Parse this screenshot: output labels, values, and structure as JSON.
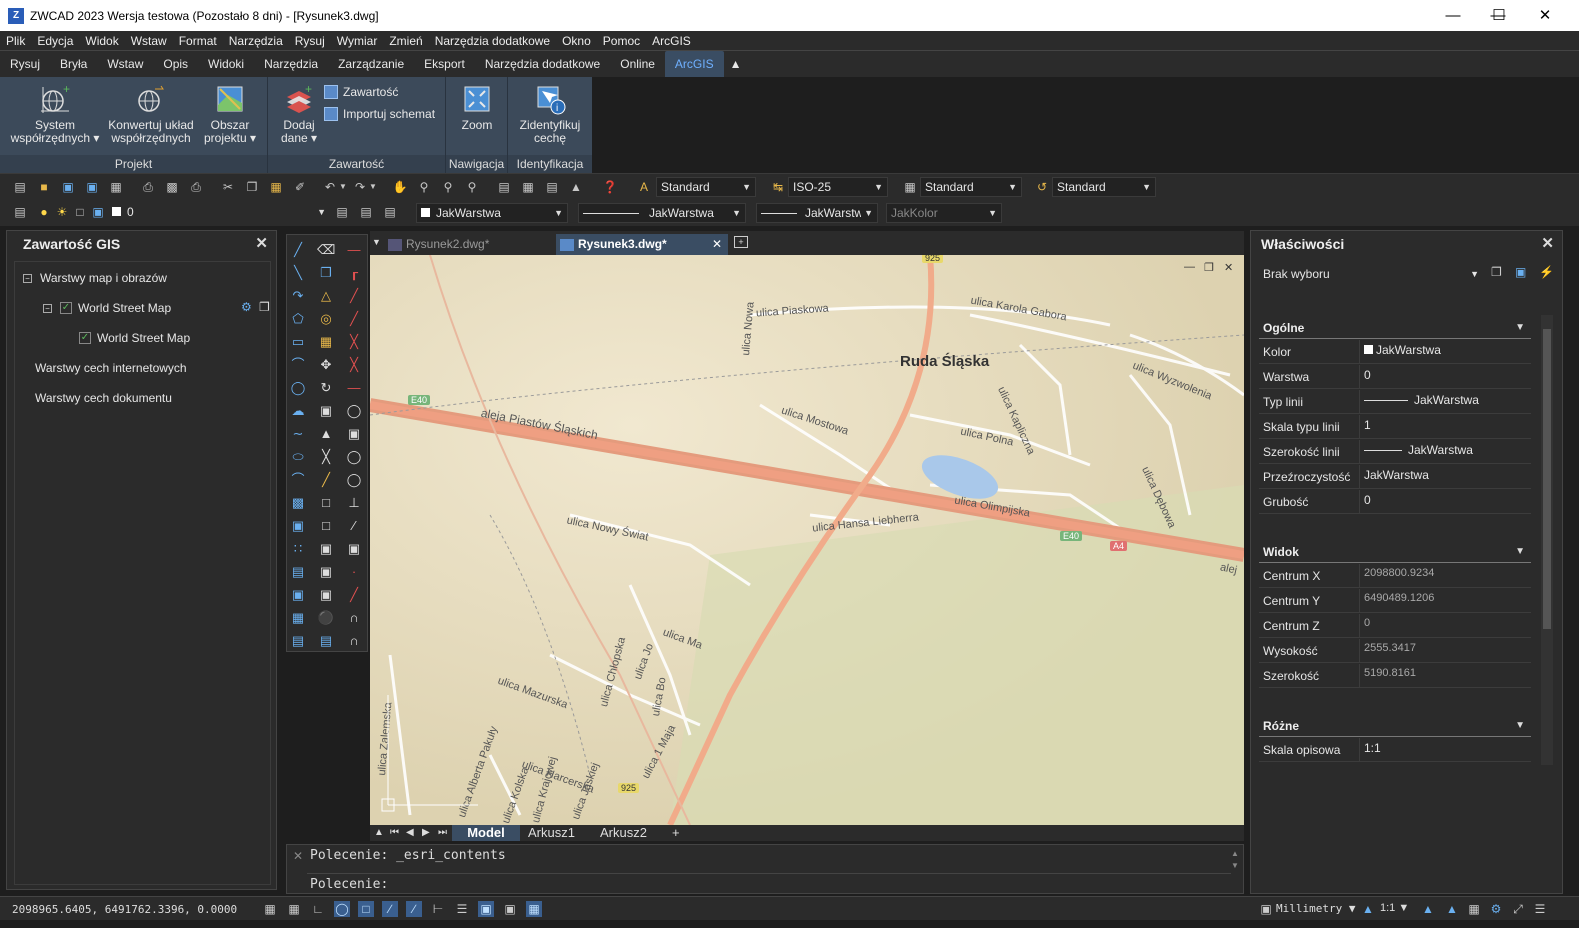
{
  "window": {
    "title": "ZWCAD 2023 Wersja testowa (Pozostało 8 dni) - [Rysunek3.dwg]"
  },
  "menu": [
    "Plik",
    "Edycja",
    "Widok",
    "Wstaw",
    "Format",
    "Narzędzia",
    "Rysuj",
    "Wymiar",
    "Zmień",
    "Narzędzia dodatkowe",
    "Okno",
    "Pomoc",
    "ArcGIS"
  ],
  "ribbon_tabs": [
    "Rysuj",
    "Bryła",
    "Wstaw",
    "Opis",
    "Widoki",
    "Narzędzia",
    "Zarządzanie",
    "Eksport",
    "Narzędzia dodatkowe",
    "Online",
    "ArcGIS"
  ],
  "ribbon": {
    "projekt": {
      "title": "Projekt",
      "system": "System\nwspółrzędnych ▾",
      "konwertuj": "Konwertuj układ\nwspółrzędnych",
      "obszar": "Obszar\nprojektu ▾"
    },
    "zawartosc": {
      "title": "Zawartość",
      "dodaj": "Dodaj\ndane ▾",
      "zawartosc_btn": "Zawartość",
      "importuj": "Importuj schemat"
    },
    "nawigacja": {
      "title": "Nawigacja",
      "zoom": "Zoom"
    },
    "identyfikacja": {
      "title": "Identyfikacja",
      "identyfikuj": "Zidentyfikuj\ncechę"
    }
  },
  "toolbar": {
    "text_style": "Standard",
    "dim_style": "ISO-25",
    "table_style": "Standard",
    "mleader_style": "Standard",
    "layer": "0",
    "color": "JakWarstwa",
    "linetype": "JakWarstwa",
    "lineweight": "JakWarstwa",
    "plotstyle": "JakKolor"
  },
  "gis_panel": {
    "title": "Zawartość GIS",
    "items": [
      "Warstwy map i obrazów",
      "World Street Map",
      "World Street Map",
      "Warstwy cech internetowych",
      "Warstwy cech dokumentu"
    ]
  },
  "doc_tabs": [
    "Rysunek2.dwg*",
    "Rysunek3.dwg*"
  ],
  "map": {
    "city": "Ruda Śląska",
    "streets": [
      "ulica Piaskowa",
      "ulica Karola Gabora",
      "ulica Nowa",
      "aleja Piastów Śląskich",
      "ulica Mostowa",
      "ulica Polna",
      "ulica Kapliczna",
      "ulica Wyzwolenia",
      "ulica Olimpijska",
      "ulica Dębowa",
      "ulica Hansa Liebherra",
      "ulica Nowy Świat",
      "ulica Mazurska",
      "ulica Chłopska",
      "ulica Harcerska",
      "ulica 1 Maja",
      "ulica Zalemska",
      "ulica Alberta Pakuły",
      "ulica Kolska",
      "ulica Krajowej",
      "ulica Jaskiej",
      "ulica Ma",
      "ulica Jo",
      "ulica Bo",
      "alej"
    ],
    "badges": [
      "E40",
      "E40",
      "A4",
      "925",
      "925"
    ]
  },
  "layout_tabs": [
    "Model",
    "Arkusz1",
    "Arkusz2",
    "+"
  ],
  "command": {
    "history": "Polecenie: _esri_contents",
    "prompt": "Polecenie:"
  },
  "properties": {
    "title": "Właściwości",
    "selection": "Brak wyboru",
    "sections": {
      "general": {
        "title": "Ogólne",
        "rows": [
          [
            "Kolor",
            "JakWarstwa"
          ],
          [
            "Warstwa",
            "0"
          ],
          [
            "Typ linii",
            "JakWarstwa"
          ],
          [
            "Skala typu linii",
            "1"
          ],
          [
            "Szerokość linii",
            "JakWarstwa"
          ],
          [
            "Przeźroczystość",
            "JakWarstwa"
          ],
          [
            "Grubość",
            "0"
          ]
        ]
      },
      "view": {
        "title": "Widok",
        "rows": [
          [
            "Centrum X",
            "2098800.9234"
          ],
          [
            "Centrum Y",
            "6490489.1206"
          ],
          [
            "Centrum Z",
            "0"
          ],
          [
            "Wysokość",
            "2555.3417"
          ],
          [
            "Szerokość",
            "5190.8161"
          ]
        ]
      },
      "misc": {
        "title": "Różne",
        "rows": [
          [
            "Skala opisowa",
            "1:1"
          ]
        ]
      }
    }
  },
  "status": {
    "coords": "2098965.6405, 6491762.3396, 0.0000",
    "units": "Millimetry",
    "scale": "1:1"
  }
}
